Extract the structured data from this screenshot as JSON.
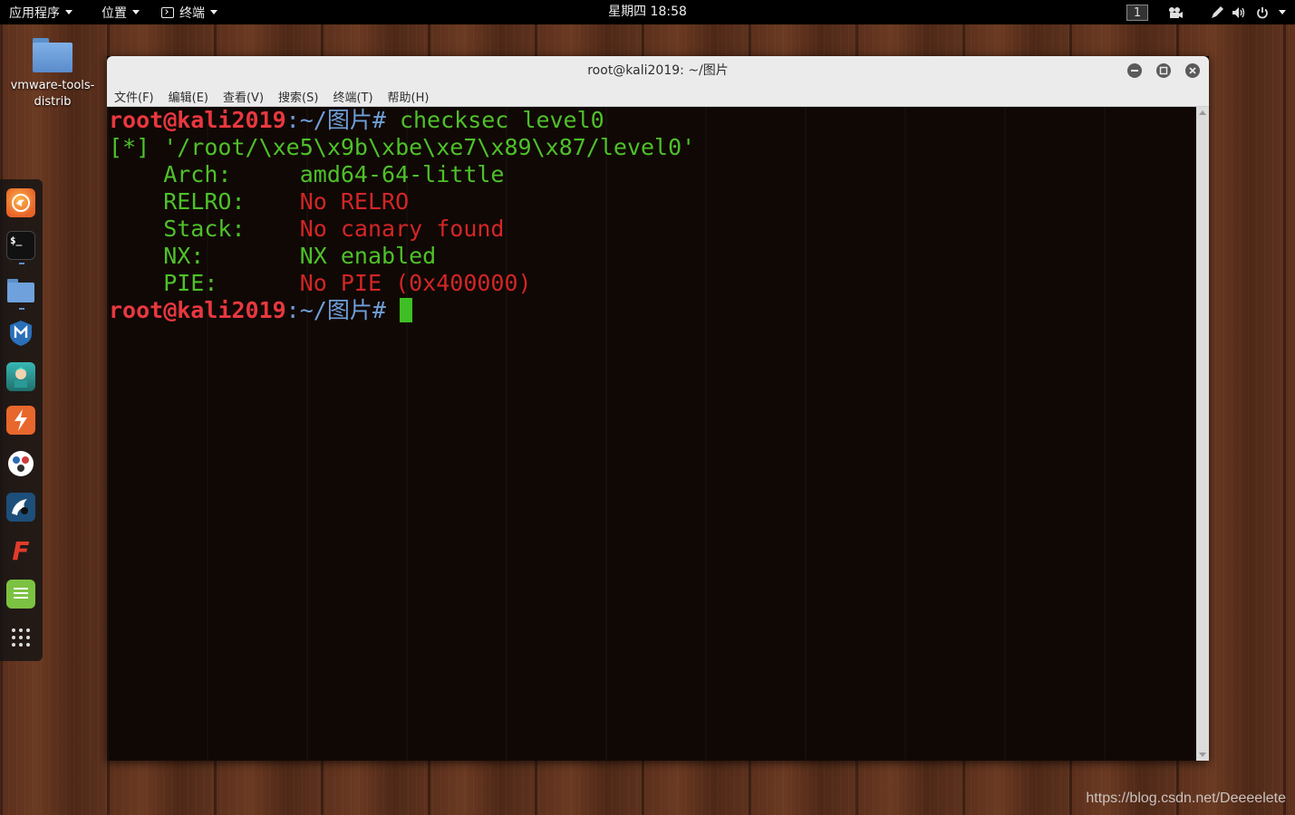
{
  "topbar": {
    "apps_label": "应用程序",
    "places_label": "位置",
    "terminal_label": "终端",
    "clock": "星期四 18:58",
    "workspace": "1"
  },
  "desktop": {
    "folder_label": "vmware-tools-distrib"
  },
  "dock": {
    "icons": [
      "firefox-icon",
      "terminal-icon",
      "files-icon",
      "metasploit-icon",
      "armitage-icon",
      "burpsuite-icon",
      "maltego-icon",
      "beef-icon",
      "faraday-icon",
      "leafpad-icon",
      "show-apps-icon"
    ]
  },
  "window": {
    "title": "root@kali2019: ~/图片",
    "menu": [
      "文件(F)",
      "编辑(E)",
      "查看(V)",
      "搜索(S)",
      "终端(T)",
      "帮助(H)"
    ]
  },
  "terminal": {
    "prompt_user": "root@kali2019",
    "prompt_path": ":~/图片",
    "prompt_hash": "# ",
    "command": "checksec level0",
    "result_line": "[*] '/root/\\xe5\\x9b\\xbe\\xe7\\x89\\x87/level0'",
    "rows": [
      {
        "key": "    Arch:     ",
        "value": "amd64-64-little",
        "status": "ok"
      },
      {
        "key": "    RELRO:    ",
        "value": "No RELRO",
        "status": "bad"
      },
      {
        "key": "    Stack:    ",
        "value": "No canary found",
        "status": "bad"
      },
      {
        "key": "    NX:       ",
        "value": "NX enabled",
        "status": "ok"
      },
      {
        "key": "    PIE:      ",
        "value": "No PIE (0x400000)",
        "status": "bad"
      }
    ]
  },
  "watermark": "https://blog.csdn.net/Deeeelete",
  "colors": {
    "prompt": "#e8383f",
    "path": "#6f9fd8",
    "ok": "#4ec12a",
    "bad": "#d22626",
    "cursor": "#3fbf26"
  }
}
